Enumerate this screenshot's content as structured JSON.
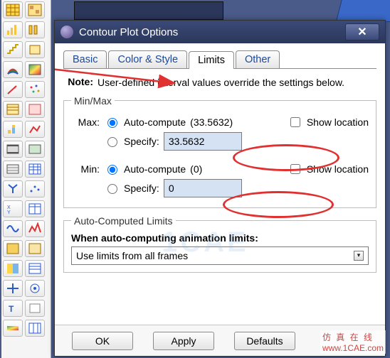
{
  "window": {
    "title": "Contour Plot Options",
    "close_glyph": "✕"
  },
  "tabs": {
    "basic": "Basic",
    "color_style": "Color & Style",
    "limits": "Limits",
    "other": "Other"
  },
  "note": {
    "label": "Note:",
    "text": "User-defined interval values override the settings below."
  },
  "minmax": {
    "legend": "Min/Max",
    "max_label": "Max:",
    "min_label": "Min:",
    "auto_compute": "Auto-compute",
    "specify": "Specify:",
    "max_auto_value": "(33.5632)",
    "min_auto_value": "(0)",
    "max_specify_value": "33.5632",
    "min_specify_value": "0",
    "show_location": "Show location"
  },
  "auto_limits": {
    "legend": "Auto-Computed Limits",
    "when_label": "When auto-computing animation limits:",
    "selected": "Use limits from all frames"
  },
  "buttons": {
    "ok": "OK",
    "apply": "Apply",
    "defaults": "Defaults"
  },
  "watermark": "仿 真 在 线",
  "watermark2": "www.1CAE.com",
  "faint": "1CAE"
}
